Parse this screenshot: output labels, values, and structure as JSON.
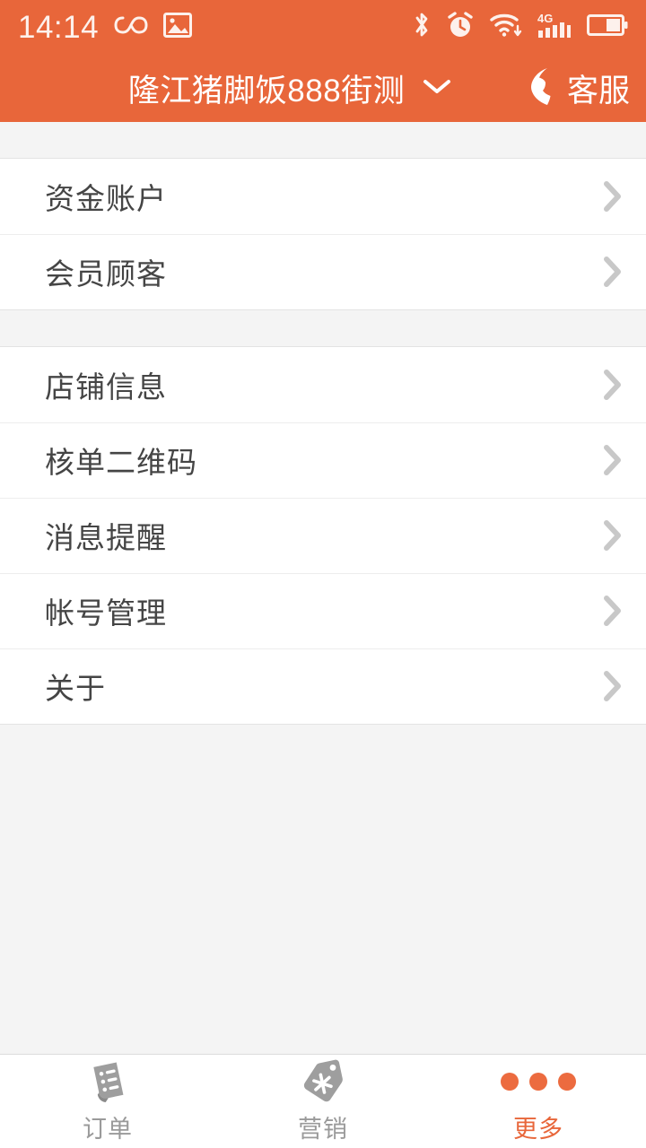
{
  "statusbar": {
    "time": "14:14",
    "icons_left": [
      "infinity-icon",
      "screenshot-image-icon"
    ],
    "icons_right": [
      "bluetooth-icon",
      "alarm-clock-icon",
      "wifi-icon",
      "signal-4g-icon",
      "battery-icon"
    ],
    "network": "4G",
    "text_color": "#fdf1ec"
  },
  "header": {
    "shop_name": "隆江猪脚饭888街测",
    "dropdown_icon": "chevron-down-icon",
    "service_label": "客服",
    "phone_icon": "phone-handset-icon",
    "background": "#e8663a"
  },
  "menu": {
    "groups": [
      {
        "rows": [
          {
            "label": "资金账户",
            "chevron": "chevron-right-icon"
          },
          {
            "label": "会员顾客",
            "chevron": "chevron-right-icon"
          }
        ]
      },
      {
        "rows": [
          {
            "label": "店铺信息",
            "chevron": "chevron-right-icon"
          },
          {
            "label": "核单二维码",
            "chevron": "chevron-right-icon"
          },
          {
            "label": "消息提醒",
            "chevron": "chevron-right-icon"
          },
          {
            "label": "帐号管理",
            "chevron": "chevron-right-icon"
          },
          {
            "label": "关于",
            "chevron": "chevron-right-icon"
          }
        ]
      }
    ]
  },
  "tabbar": {
    "tabs": [
      {
        "label": "订单",
        "icon": "receipt-order-icon",
        "active": false
      },
      {
        "label": "营销",
        "icon": "price-tag-marketing-icon",
        "active": false
      },
      {
        "label": "更多",
        "icon": "more-dots-icon",
        "active": true
      }
    ],
    "active_color": "#e8663a",
    "inactive_color": "#9a9a9a"
  }
}
